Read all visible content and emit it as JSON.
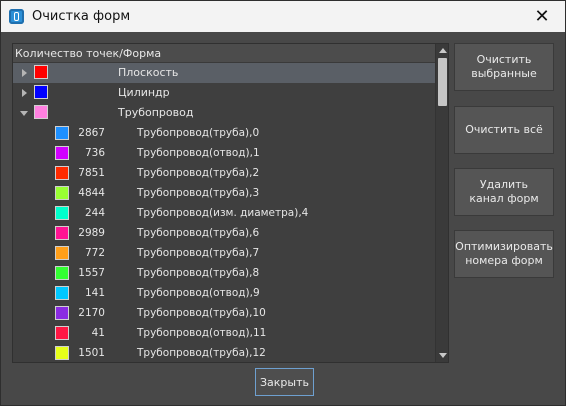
{
  "window": {
    "title": "Очистка форм",
    "close_glyph": "✕"
  },
  "tree": {
    "header": "Количество точек/Форма",
    "groups": [
      {
        "label": "Плоскость",
        "color": "#ff0000",
        "expanded": false,
        "selected": true
      },
      {
        "label": "Цилиндр",
        "color": "#0000ff",
        "expanded": false,
        "selected": false
      },
      {
        "label": "Трубопровод",
        "color": "#ff80e0",
        "expanded": true,
        "selected": false
      }
    ],
    "children": [
      {
        "count": "2867",
        "label": "Трубопровод(труба),0",
        "color": "#1e90ff"
      },
      {
        "count": "736",
        "label": "Трубопровод(отвод),1",
        "color": "#d100ff"
      },
      {
        "count": "7851",
        "label": "Трубопровод(труба),2",
        "color": "#ff2a00"
      },
      {
        "count": "4844",
        "label": "Трубопровод(труба),3",
        "color": "#99ff33"
      },
      {
        "count": "244",
        "label": "Трубопровод(изм. диаметра),4",
        "color": "#00ffcc"
      },
      {
        "count": "2989",
        "label": "Трубопровод(труба),6",
        "color": "#ff1493"
      },
      {
        "count": "772",
        "label": "Трубопровод(труба),7",
        "color": "#ff9f1a"
      },
      {
        "count": "1557",
        "label": "Трубопровод(труба),8",
        "color": "#33ff33"
      },
      {
        "count": "141",
        "label": "Трубопровод(отвод),9",
        "color": "#00c8ff"
      },
      {
        "count": "2170",
        "label": "Трубопровод(труба),10",
        "color": "#8a2be2"
      },
      {
        "count": "41",
        "label": "Трубопровод(отвод),11",
        "color": "#ff1744"
      },
      {
        "count": "1501",
        "label": "Трубопровод(труба),12",
        "color": "#e6ff1a"
      }
    ]
  },
  "buttons": {
    "clear_selected": "Очистить\nвыбранные",
    "clear_all": "Очистить всё",
    "delete_channel": "Удалить\nканал форм",
    "optimize": "Оптимизировать\nномера форм",
    "close": "Закрыть"
  }
}
